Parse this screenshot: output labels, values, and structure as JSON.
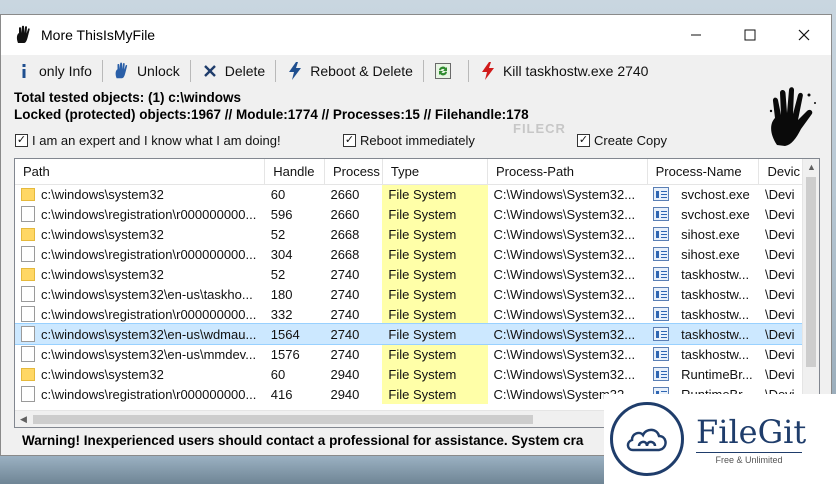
{
  "window": {
    "title": "More ThisIsMyFile"
  },
  "toolbar": {
    "items": [
      {
        "label": "only Info",
        "icon": "info-icon"
      },
      {
        "label": "Unlock",
        "icon": "hand-icon"
      },
      {
        "label": "Delete",
        "icon": "close-x-icon"
      },
      {
        "label": "Reboot & Delete",
        "icon": "lightning-icon"
      },
      {
        "label": "",
        "icon": "refresh-icon"
      },
      {
        "label": "Kill taskhostw.exe 2740",
        "icon": "lightning-red-icon"
      }
    ]
  },
  "info": {
    "line1": "Total tested objects: (1) c:\\windows",
    "line2": "Locked (protected) objects:1967  //  Module:1774  //  Processes:15  //  Filehandle:178"
  },
  "options": {
    "expert": {
      "label": "I am an expert and I know what I am doing!",
      "checked": true
    },
    "reboot": {
      "label": "Reboot immediately",
      "checked": true
    },
    "copy": {
      "label": "Create Copy",
      "checked": true
    }
  },
  "watermark_top": "FILECR",
  "grid": {
    "columns": [
      "Path",
      "Handle",
      "Process",
      "Type",
      "Process-Path",
      "Process-Name",
      "Devic"
    ],
    "rows": [
      {
        "icon": "folder",
        "path": "c:\\windows\\system32",
        "handle": "60",
        "process": "2660",
        "type": "File System",
        "ppath": "C:\\Windows\\System32...",
        "pname": "svchost.exe",
        "dev": "\\Devi",
        "selected": false
      },
      {
        "icon": "file",
        "path": "c:\\windows\\registration\\r000000000...",
        "handle": "596",
        "process": "2660",
        "type": "File System",
        "ppath": "C:\\Windows\\System32...",
        "pname": "svchost.exe",
        "dev": "\\Devi",
        "selected": false
      },
      {
        "icon": "folder",
        "path": "c:\\windows\\system32",
        "handle": "52",
        "process": "2668",
        "type": "File System",
        "ppath": "C:\\Windows\\System32...",
        "pname": "sihost.exe",
        "dev": "\\Devi",
        "selected": false
      },
      {
        "icon": "file",
        "path": "c:\\windows\\registration\\r000000000...",
        "handle": "304",
        "process": "2668",
        "type": "File System",
        "ppath": "C:\\Windows\\System32...",
        "pname": "sihost.exe",
        "dev": "\\Devi",
        "selected": false
      },
      {
        "icon": "folder",
        "path": "c:\\windows\\system32",
        "handle": "52",
        "process": "2740",
        "type": "File System",
        "ppath": "C:\\Windows\\System32...",
        "pname": "taskhostw...",
        "dev": "\\Devi",
        "selected": false
      },
      {
        "icon": "file",
        "path": "c:\\windows\\system32\\en-us\\taskho...",
        "handle": "180",
        "process": "2740",
        "type": "File System",
        "ppath": "C:\\Windows\\System32...",
        "pname": "taskhostw...",
        "dev": "\\Devi",
        "selected": false
      },
      {
        "icon": "file",
        "path": "c:\\windows\\registration\\r000000000...",
        "handle": "332",
        "process": "2740",
        "type": "File System",
        "ppath": "C:\\Windows\\System32...",
        "pname": "taskhostw...",
        "dev": "\\Devi",
        "selected": false
      },
      {
        "icon": "file",
        "path": "c:\\windows\\system32\\en-us\\wdmau...",
        "handle": "1564",
        "process": "2740",
        "type": "File System",
        "ppath": "C:\\Windows\\System32...",
        "pname": "taskhostw...",
        "dev": "\\Devi",
        "selected": true
      },
      {
        "icon": "file",
        "path": "c:\\windows\\system32\\en-us\\mmdev...",
        "handle": "1576",
        "process": "2740",
        "type": "File System",
        "ppath": "C:\\Windows\\System32...",
        "pname": "taskhostw...",
        "dev": "\\Devi",
        "selected": false
      },
      {
        "icon": "folder",
        "path": "c:\\windows\\system32",
        "handle": "60",
        "process": "2940",
        "type": "File System",
        "ppath": "C:\\Windows\\System32...",
        "pname": "RuntimeBr...",
        "dev": "\\Devi",
        "selected": false
      },
      {
        "icon": "file",
        "path": "c:\\windows\\registration\\r000000000...",
        "handle": "416",
        "process": "2940",
        "type": "File System",
        "ppath": "C:\\Windows\\System32...",
        "pname": "RuntimeBr...",
        "dev": "\\Devi",
        "selected": false
      }
    ]
  },
  "warning": "Warning! Inexperienced users should contact a professional for assistance. System cra",
  "filegit": {
    "name": "FileGit",
    "tagline": "Free & Unlimited"
  },
  "colors": {
    "type_highlight": "#ffffa8",
    "selected_row": "#cce8ff",
    "filegit_brand": "#1f3d6b"
  }
}
